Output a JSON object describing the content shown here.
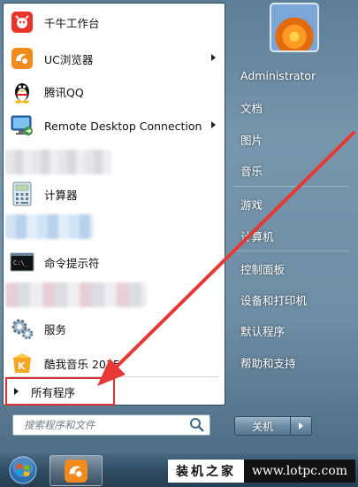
{
  "programs": [
    {
      "label": "千牛工作台",
      "icon": "qianniu-icon",
      "has_submenu": false
    },
    {
      "label": "UC浏览器",
      "icon": "uc-browser-icon",
      "has_submenu": true
    },
    {
      "label": "腾讯QQ",
      "icon": "qq-penguin-icon",
      "has_submenu": false
    },
    {
      "label": "Remote Desktop Connection",
      "icon": "remote-desktop-icon",
      "has_submenu": true
    },
    {
      "label": "计算器",
      "icon": "calculator-icon",
      "has_submenu": false
    },
    {
      "label": "命令提示符",
      "icon": "command-prompt-icon",
      "has_submenu": false
    },
    {
      "label": "服务",
      "icon": "services-gear-icon",
      "has_submenu": false
    },
    {
      "label": "酷我音乐 2015",
      "icon": "kuwo-music-icon",
      "has_submenu": false
    }
  ],
  "all_programs": {
    "label": "所有程序"
  },
  "search": {
    "placeholder": "搜索程序和文件"
  },
  "right_pane": {
    "user_name": "Administrator",
    "items": [
      "文档",
      "图片",
      "音乐",
      "游戏",
      "计算机",
      "控制面板",
      "设备和打印机",
      "默认程序",
      "帮助和支持"
    ]
  },
  "shutdown": {
    "label": "关机"
  },
  "watermark": {
    "cn": "装机之家",
    "url": "www.lotpc.com"
  },
  "colors": {
    "highlight_box": "#d93030",
    "annotation_arrow": "#e53935",
    "menu_right_bg": "#6e8ea5"
  }
}
